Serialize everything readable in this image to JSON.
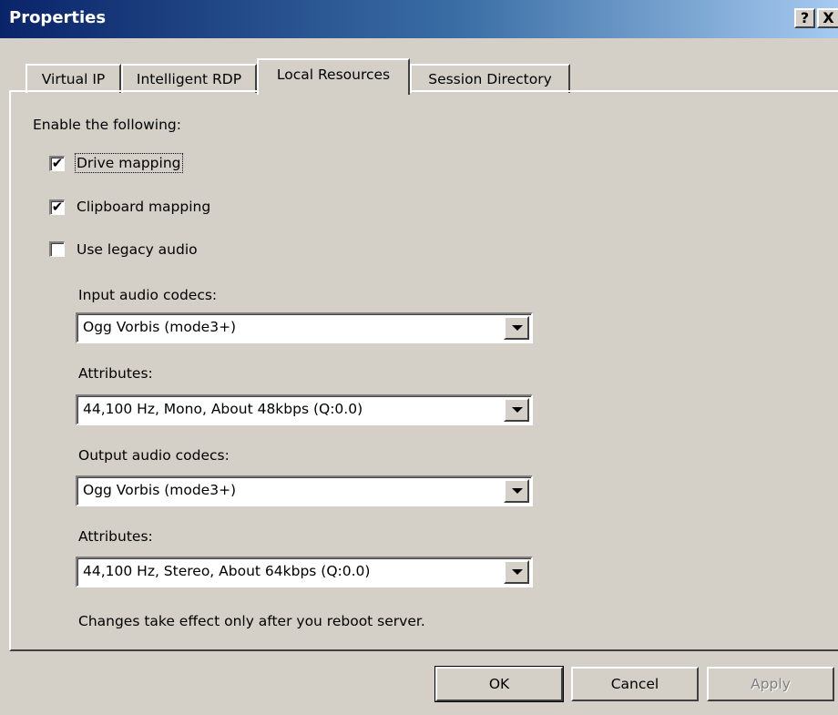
{
  "window": {
    "title": "Properties",
    "help_glyph": "?",
    "close_glyph": "X"
  },
  "tabs": [
    {
      "label": "Virtual IP",
      "active": false
    },
    {
      "label": "Intelligent RDP",
      "active": false
    },
    {
      "label": "Local Resources",
      "active": true
    },
    {
      "label": "Session Directory",
      "active": false
    }
  ],
  "panel": {
    "heading": "Enable the following:",
    "checkboxes": [
      {
        "label": "Drive mapping",
        "checked": true,
        "mark": "✔"
      },
      {
        "label": "Clipboard mapping",
        "checked": true,
        "mark": "✔"
      },
      {
        "label": "Use legacy audio",
        "checked": false,
        "mark": ""
      }
    ],
    "input_codecs": {
      "label": "Input audio codecs:",
      "value": "Ogg Vorbis (mode3+)"
    },
    "input_attributes": {
      "label": "Attributes:",
      "value": "44,100 Hz, Mono, About 48kbps (Q:0.0)"
    },
    "output_codecs": {
      "label": "Output audio codecs:",
      "value": "Ogg Vorbis (mode3+)"
    },
    "output_attributes": {
      "label": "Attributes:",
      "value": "44,100 Hz, Stereo, About 64kbps (Q:0.0)"
    },
    "note": "Changes take effect only after you reboot server."
  },
  "buttons": {
    "ok": "OK",
    "cancel": "Cancel",
    "apply": "Apply"
  }
}
